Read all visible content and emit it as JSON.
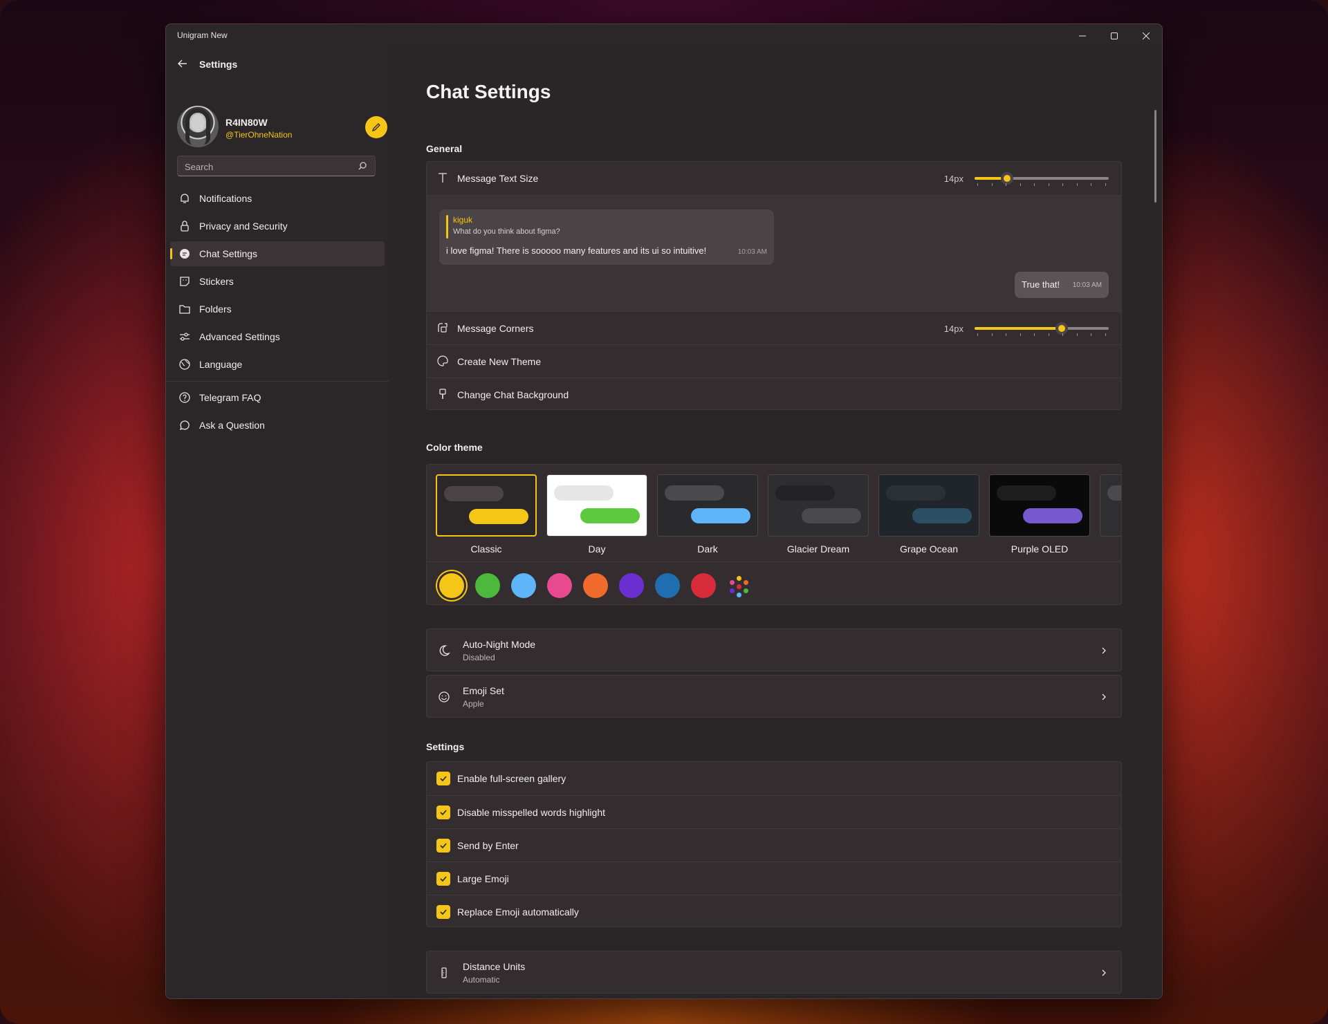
{
  "window": {
    "title": "Unigram New"
  },
  "sidebar": {
    "header": "Settings",
    "profile": {
      "name": "R4IN80W",
      "handle": "@TierOhneNation"
    },
    "search_placeholder": "Search",
    "items": [
      {
        "label": "Notifications",
        "icon": "bell-icon"
      },
      {
        "label": "Privacy and Security",
        "icon": "lock-icon"
      },
      {
        "label": "Chat Settings",
        "icon": "chat-icon",
        "active": true
      },
      {
        "label": "Stickers",
        "icon": "sticker-icon"
      },
      {
        "label": "Folders",
        "icon": "folder-icon"
      },
      {
        "label": "Advanced Settings",
        "icon": "sliders-icon"
      },
      {
        "label": "Language",
        "icon": "globe-icon"
      },
      {
        "label": "Telegram FAQ",
        "icon": "help-icon"
      },
      {
        "label": "Ask a Question",
        "icon": "question-chat-icon"
      }
    ]
  },
  "main": {
    "title": "Chat Settings",
    "general": {
      "section_title": "General",
      "message_text_size": {
        "label": "Message Text Size",
        "value": "14px",
        "level": 0.24
      },
      "preview": {
        "quote_name": "kiguk",
        "quote_text": "What do you think about figma?",
        "incoming_text": "i love figma! There is sooooo many features and its ui so intuitive!",
        "incoming_time": "10:03 AM",
        "outgoing_text": "True that!",
        "outgoing_time": "10:03 AM"
      },
      "message_corners": {
        "label": "Message Corners",
        "value": "14px",
        "level": 0.65
      },
      "create_theme": "Create New Theme",
      "change_background": "Change Chat Background"
    },
    "color_theme": {
      "section_title": "Color theme",
      "themes": [
        {
          "name": "Classic",
          "bg": "#2b2628",
          "in": "#4a4446",
          "out": "#f5c518",
          "selected": true
        },
        {
          "name": "Day",
          "bg": "#ffffff",
          "in": "#e6e6e6",
          "out": "#5cc93f"
        },
        {
          "name": "Dark",
          "bg": "#2a2a2c",
          "in": "#4a4a4c",
          "out": "#5eb5f7"
        },
        {
          "name": "Glacier Dream",
          "bg": "#2e2e30",
          "in": "#232325",
          "out": "#4a4a4c"
        },
        {
          "name": "Grape Ocean",
          "bg": "#1f252b",
          "in": "#2a3036",
          "out": "#2d4f63"
        },
        {
          "name": "Purple OLED",
          "bg": "#0a0a0a",
          "in": "#1e1e1e",
          "out": "#7759cf"
        }
      ],
      "accents": [
        "#f5c518",
        "#4cb83c",
        "#5eb5f7",
        "#e84a8f",
        "#f06b2b",
        "#6b2fd1",
        "#1f6fb0",
        "#d92c3a"
      ],
      "selected_accent": "#f5c518"
    },
    "auto_night": {
      "label": "Auto-Night Mode",
      "value": "Disabled"
    },
    "emoji_set": {
      "label": "Emoji Set",
      "value": "Apple"
    },
    "settings": {
      "section_title": "Settings",
      "checkboxes": [
        {
          "label": "Enable full-screen gallery",
          "checked": true
        },
        {
          "label": "Disable misspelled words highlight",
          "checked": true
        },
        {
          "label": "Send by Enter",
          "checked": true
        },
        {
          "label": "Large Emoji",
          "checked": true
        },
        {
          "label": "Replace Emoji automatically",
          "checked": true
        }
      ]
    },
    "distance_units": {
      "label": "Distance Units",
      "value": "Automatic"
    }
  }
}
